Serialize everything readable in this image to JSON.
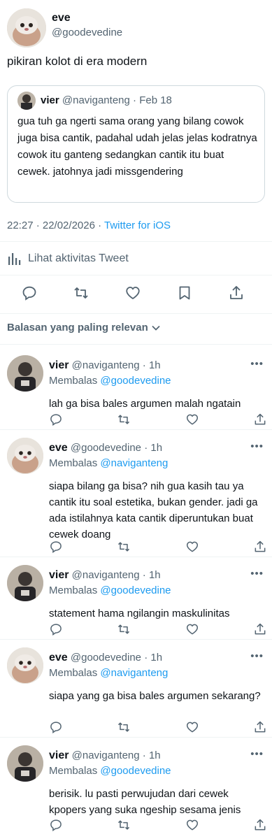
{
  "main_tweet": {
    "author_name": "eve",
    "author_handle": "@goodevedine",
    "text": "pikiran kolot di era modern",
    "quoted": {
      "author_name": "vier",
      "author_handle": "@naviganteng",
      "separator": "·",
      "date": "Feb 18",
      "text": "gua tuh ga ngerti sama orang yang bilang cowok juga bisa cantik, padahal udah jelas jelas kodratnya cowok itu ganteng sedangkan cantik itu buat cewek. jatohnya jadi missgendering"
    },
    "timestamp": "22:27 · 22/02/2026 · ",
    "source": "Twitter for iOS",
    "activity_label": "Lihat aktivitas Tweet"
  },
  "replies_header": "Balasan yang paling relevan",
  "replies": [
    {
      "name": "vier",
      "handle": "@naviganteng",
      "time": "· 1h",
      "reply_prefix": "Membalas",
      "reply_to": "@goodevedine",
      "text": "lah ga bisa bales argumen malah ngatain"
    },
    {
      "name": "eve",
      "handle": "@goodevedine",
      "time": "· 1h",
      "reply_prefix": "Membalas",
      "reply_to": "@naviganteng",
      "text": "siapa bilang ga bisa? nih gua kasih tau ya cantik itu soal estetika, bukan gender. jadi ga ada istilahnya kata cantik diperuntukan buat cewek doang"
    },
    {
      "name": "vier",
      "handle": "@naviganteng",
      "time": "· 1h",
      "reply_prefix": "Membalas",
      "reply_to": "@goodevedine",
      "text": "statement hama ngilangin maskulinitas"
    },
    {
      "name": "eve",
      "handle": "@goodevedine",
      "time": "· 1h",
      "reply_prefix": "Membalas",
      "reply_to": "@naviganteng",
      "text": "siapa yang ga bisa bales argumen sekarang?"
    },
    {
      "name": "vier",
      "handle": "@naviganteng",
      "time": "· 1h",
      "reply_prefix": "Membalas",
      "reply_to": "@goodevedine",
      "text": "berisik. lu pasti perwujudan dari cewek kpopers yang suka ngeship sesama jenis"
    }
  ],
  "colors": {
    "accent": "#1d9bf0",
    "muted": "#536471",
    "divider": "#eff3f4",
    "text": "#0f1419"
  },
  "icons": [
    "reply-icon",
    "retweet-icon",
    "like-icon",
    "bookmark-icon",
    "share-icon",
    "analytics-icon",
    "chevron-down-icon",
    "more-icon"
  ]
}
